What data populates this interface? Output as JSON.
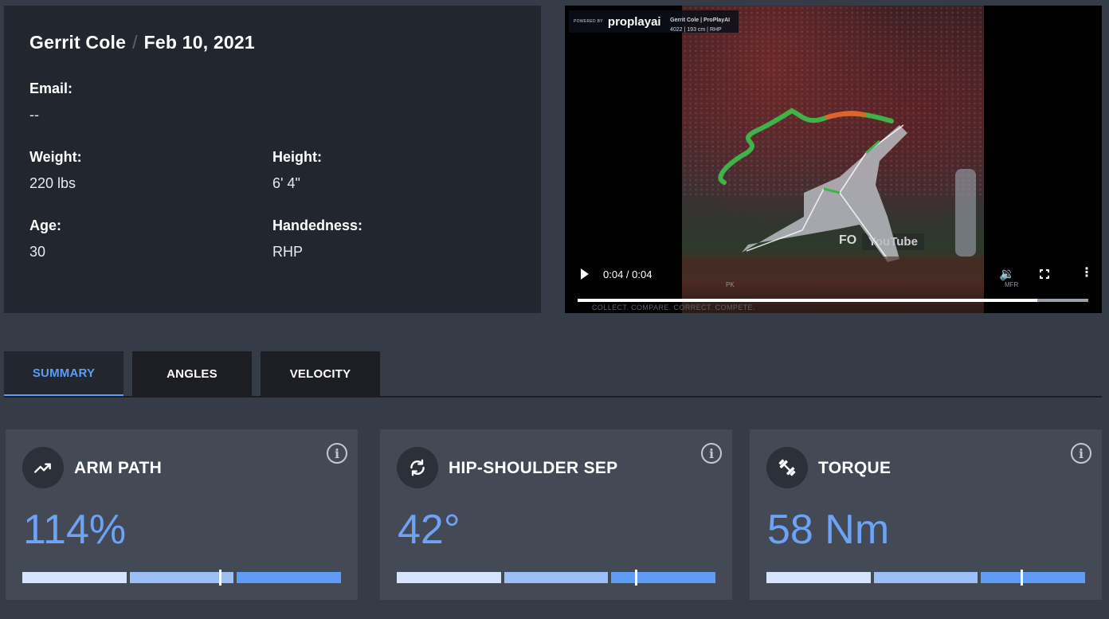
{
  "profile": {
    "name": "Gerrit Cole",
    "date": "Feb 10, 2021",
    "email_label": "Email:",
    "email_value": "--",
    "weight_label": "Weight:",
    "weight_value": "220 lbs",
    "height_label": "Height:",
    "height_value": "6' 4\"",
    "age_label": "Age:",
    "age_value": "30",
    "handedness_label": "Handedness:",
    "handedness_value": "RHP"
  },
  "video": {
    "powered_by": "POWERED BY",
    "brand": "proplayai",
    "meta_line1": "Gerrit Cole  |  ProPlayAI",
    "meta_line2": "4022  |  193 cm  |  RHP",
    "time": "0:04 / 0:04",
    "marker_pk": "PK",
    "marker_mfr": "MFR",
    "tagline": "COLLECT. COMPARE. CORRECT. COMPETE.",
    "progress": 0.9,
    "badge_fox": "FO",
    "badge_youtube": "YouTube"
  },
  "tabs": [
    {
      "label": "SUMMARY",
      "active": true
    },
    {
      "label": "ANGLES",
      "active": false
    },
    {
      "label": "VELOCITY",
      "active": false
    }
  ],
  "metrics": [
    {
      "title": "ARM PATH",
      "value": "114%",
      "icon": "trending-up-icon",
      "gauge_fraction": 0.62
    },
    {
      "title": "HIP-SHOULDER SEP",
      "value": "42°",
      "icon": "rotate-icon",
      "gauge_fraction": 0.75
    },
    {
      "title": "TORQUE",
      "value": "58 Nm",
      "icon": "dumbbell-icon",
      "gauge_fraction": 0.8
    }
  ],
  "colors": {
    "accent": "#5f9cf5",
    "value_blue": "#6da2f4",
    "card_bg": "#434955",
    "panel_bg": "#22262e",
    "page_bg": "#363c47"
  }
}
